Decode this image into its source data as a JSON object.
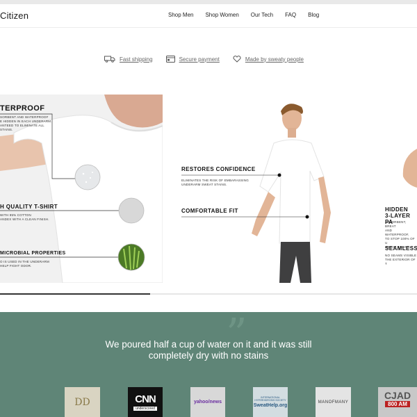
{
  "brand": {
    "name": "Citizen"
  },
  "nav": {
    "items": [
      "Shop Men",
      "Shop Women",
      "Our Tech",
      "FAQ",
      "Blog"
    ]
  },
  "usp": [
    {
      "icon": "truck-icon",
      "label": "Fast shipping"
    },
    {
      "icon": "credit-card-icon",
      "label": "Secure payment"
    },
    {
      "icon": "heart-icon",
      "label": "Made by sweaty people"
    }
  ],
  "slide1": {
    "features": [
      {
        "title": "TERPROOF",
        "desc": [
          "SORBENT AND WATERPROOF",
          "E HIDDEN IN EACH UNDERARM.",
          "ANTEED TO ELIMINATE ALL",
          "STAINS."
        ]
      },
      {
        "title": "H QUALITY T-SHIRT",
        "desc": [
          "WITH 95% COTTON",
          "ANDEX WITH A CLEAN FINISH."
        ]
      },
      {
        "title": "MICROBIAL PROPERTIES",
        "desc": [
          "O IS USED IN THE UNDERARM",
          "HELP FIGHT ODOR."
        ]
      }
    ]
  },
  "slide2": {
    "features": [
      {
        "title": "RESTORES CONFIDENCE",
        "desc": [
          "ELIMINATES THE RISK OF EMBARASSING",
          "UNDERARM SWEAT STAINS."
        ]
      },
      {
        "title": "COMFORTABLE FIT",
        "desc": []
      }
    ],
    "right_features": [
      {
        "title_lines": [
          "HIDDEN",
          "3-LAYER PA"
        ],
        "desc": [
          "ABSORBENT, BREAT",
          "AND WATERPROOF,",
          "TO STOP 100% OF U",
          "SWEAT STAINS."
        ]
      },
      {
        "title_lines": [
          "SEAMLESS"
        ],
        "desc": [
          "NO SEAMS VISIBLE",
          "THE EXTERIOR OF T"
        ]
      }
    ]
  },
  "slider_progress": 0.36,
  "testimonial": {
    "quote": "We poured half a cup of water on it and it was still completely dry with no stains",
    "quote_mark": "”"
  },
  "press_logos": [
    {
      "name": "DD"
    },
    {
      "name": "CNN",
      "sub": "underscored"
    },
    {
      "name": "yahoo/news"
    },
    {
      "name": "SweatHelp.org",
      "sub": "INTERNATIONAL HYPERHIDROSIS SOCIETY"
    },
    {
      "name": "MANOFMANY"
    },
    {
      "name": "CJAD",
      "sub": "800 AM"
    }
  ],
  "colors": {
    "testimonial_bg": "#5f8577",
    "progress": "#333333"
  }
}
